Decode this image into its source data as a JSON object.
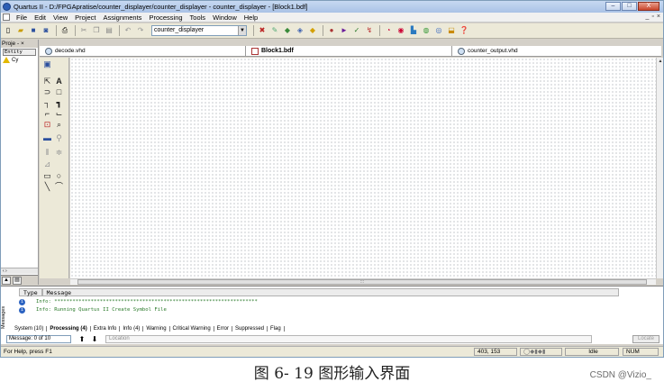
{
  "window": {
    "title": "Quartus II - D:/FPGApratise/counter_displayer/counter_displayer - counter_displayer - [Block1.bdf]",
    "controls": [
      "–",
      "□",
      "X"
    ]
  },
  "menu": [
    "File",
    "Edit",
    "View",
    "Project",
    "Assignments",
    "Processing",
    "Tools",
    "Window",
    "Help"
  ],
  "mdi_controls": [
    "_",
    "▫",
    "×"
  ],
  "toolbar": {
    "project_select": "counter_displayer",
    "left_icons": [
      "new-icon",
      "open-icon",
      "save-icon",
      "save-all-icon",
      "print-icon",
      "cut-icon",
      "copy-icon",
      "paste-icon",
      "undo-icon",
      "redo-icon"
    ],
    "right_icons": [
      "assignment-editor-icon",
      "pin-planner-icon",
      "settings-icon",
      "chip-icon",
      "stop-icon",
      "start-compilation-icon",
      "analysis-icon",
      "synthesis-icon",
      "timing-icon",
      "timequest-icon",
      "netlist-viewer-icon",
      "programmer-icon",
      "megawizard-icon",
      "sopc-icon",
      "help-icon"
    ]
  },
  "project_navigator": {
    "header": "Proje - ×",
    "entity_label": "Entity",
    "node_label": "Cy"
  },
  "document_tabs": [
    {
      "label": "decode.vhd",
      "active": false
    },
    {
      "label": "Block1.bdf",
      "active": true
    },
    {
      "label": "counter_output.vhd",
      "active": false
    }
  ],
  "block_tools": [
    "select-tool-icon",
    "text-tool-icon",
    "symbol-tool-icon",
    "pin-tool-icon",
    "orthogonal-node-icon",
    "orthogonal-bus-icon",
    "partial-line-icon",
    "use-rubberbanding-icon",
    "conduit-line-icon",
    "zoom-tool-icon",
    "full-screen-icon",
    "find-icon",
    "flip-horizontal-icon",
    "flip-vertical-icon",
    "rotate-icon",
    "rectangle-icon",
    "oval-icon",
    "line-icon",
    "arc-icon"
  ],
  "messages": {
    "columns": [
      "Type",
      "Message"
    ],
    "lines": [
      "Info: *******************************************************************",
      "Info: Running Quartus II Create Symbol File"
    ],
    "tabs": [
      "System (10)",
      "Processing (4)",
      "Extra Info",
      "Info (4)",
      "Warning",
      "Critical Warning",
      "Error",
      "Suppressed",
      "Flag"
    ],
    "active_tab": "Processing (4)",
    "count": "Message: 0 of 10",
    "location_placeholder": "Location",
    "locate_button": "Locate",
    "side_label": "Messages"
  },
  "statusbar": {
    "help": "For Help, press F1",
    "coords": "403, 153",
    "mode": "Idle",
    "num": "NUM"
  },
  "caption": "图 6- 19 图形输入界面",
  "watermark": "CSDN @Vizio_"
}
